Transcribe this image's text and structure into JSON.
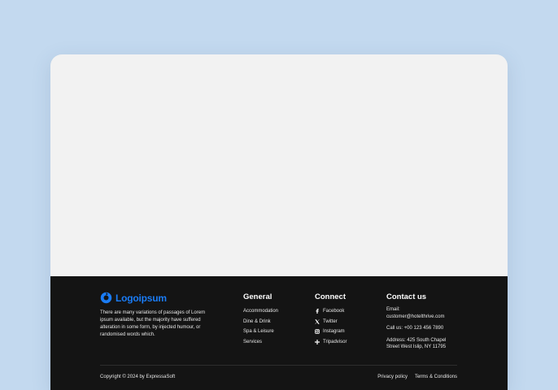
{
  "colors": {
    "page_bg": "#c3d9ef",
    "card_bg": "#f2f2f2",
    "footer_bg": "#141414",
    "brand": "#1a7cf5"
  },
  "brand": {
    "name": "Logoipsum",
    "description": "There are many variations of passages of Lorem ipsum available, but the majority have suffered alteration in some form, by injected humour, or randomised words which."
  },
  "general": {
    "heading": "General",
    "items": [
      "Accommodation",
      "Dine & Drink",
      "Spa & Leisure",
      "Services"
    ]
  },
  "connect": {
    "heading": "Connect",
    "items": [
      {
        "icon": "facebook-icon",
        "label": "Facebook"
      },
      {
        "icon": "x-twitter-icon",
        "label": "Twitter"
      },
      {
        "icon": "instagram-icon",
        "label": "Instagram"
      },
      {
        "icon": "tripadvisor-icon",
        "label": "Tripadvisor"
      }
    ]
  },
  "contact": {
    "heading": "Contact us",
    "email_label": "Email:",
    "email": "customer@hotelthrive.com",
    "phone": "Call us: +00 123 456 7890",
    "address_line1": "Address: 425 South Chapel",
    "address_line2": "Street West Islip, NY 11795"
  },
  "bottom": {
    "copyright": "Copyright © 2024 by ExpressaSoft",
    "privacy": "Privacy policy",
    "terms": "Terms & Conditions"
  }
}
